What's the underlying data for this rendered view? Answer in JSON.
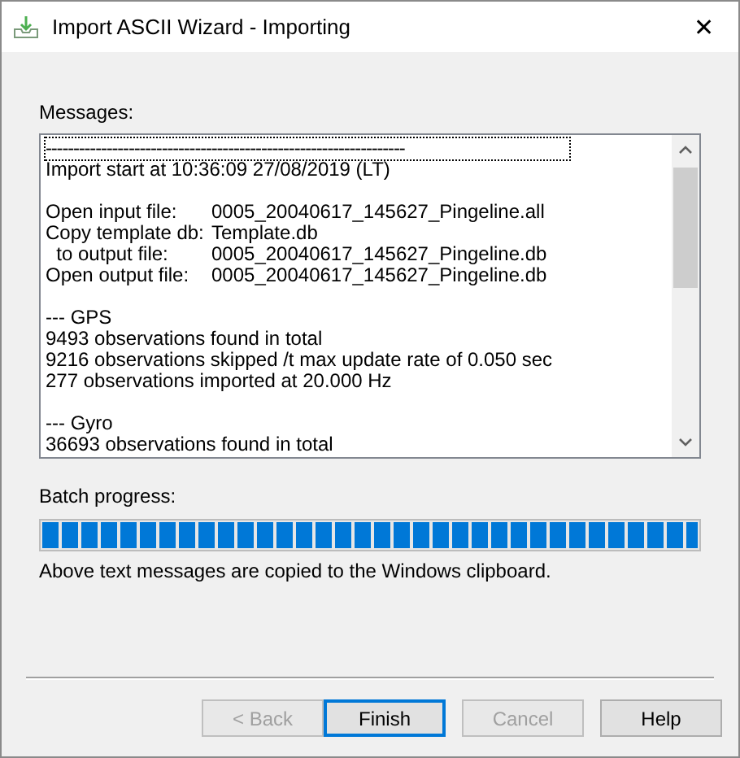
{
  "window": {
    "title": "Import ASCII Wizard - Importing",
    "close": "✕"
  },
  "messages": {
    "label": "Messages:",
    "groups": [
      [
        {
          "kind": "text",
          "text": "-----------------------------------------------------------------"
        },
        {
          "kind": "text",
          "text": "Import start at 10:36:09 27/08/2019 (LT)"
        }
      ],
      [
        {
          "kind": "pair",
          "label": "Open input file:",
          "value": "0005_20040617_145627_Pingeline.all"
        },
        {
          "kind": "pair",
          "label": "Copy template db:",
          "value": "Template.db"
        },
        {
          "kind": "pair",
          "label": "  to output file:",
          "value": "0005_20040617_145627_Pingeline.db"
        },
        {
          "kind": "pair",
          "label": "Open output file:",
          "value": "0005_20040617_145627_Pingeline.db"
        }
      ],
      [
        {
          "kind": "text",
          "text": "--- GPS"
        },
        {
          "kind": "text",
          "text": "9493 observations found in total"
        },
        {
          "kind": "text",
          "text": "9216 observations skipped /t max update rate of 0.050 sec"
        },
        {
          "kind": "text",
          "text": "277 observations imported at 20.000 Hz"
        }
      ],
      [
        {
          "kind": "text",
          "text": "--- Gyro"
        },
        {
          "kind": "text",
          "text": "36693 observations found in total"
        }
      ]
    ]
  },
  "progress": {
    "label": "Batch progress:",
    "level": 1.0
  },
  "note": "Above text messages are copied to the Windows clipboard.",
  "buttons": [
    {
      "label": "< Back",
      "disabled": true,
      "default": false
    },
    {
      "label": "Finish",
      "disabled": false,
      "default": true
    },
    {
      "label": "Cancel",
      "disabled": true,
      "default": false
    },
    {
      "label": "Help",
      "disabled": false,
      "default": false
    }
  ]
}
